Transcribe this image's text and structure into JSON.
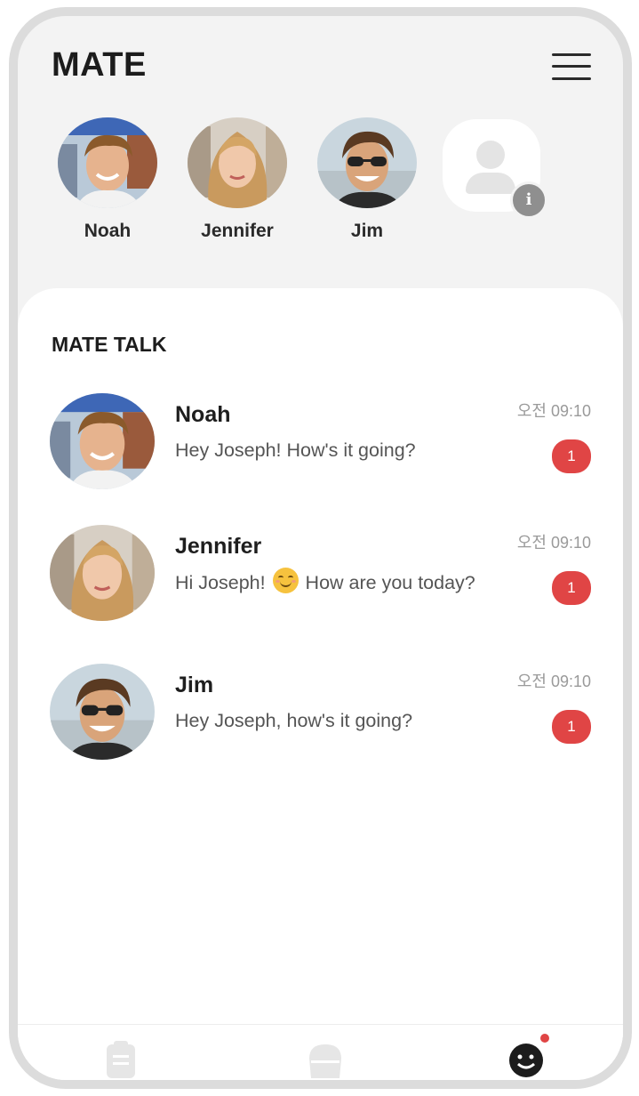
{
  "app": {
    "title": "MATE"
  },
  "mates": [
    {
      "name": "Noah"
    },
    {
      "name": "Jennifer"
    },
    {
      "name": "Jim"
    }
  ],
  "talk": {
    "section_title": "MATE TALK",
    "chats": [
      {
        "name": "Noah",
        "message": "Hey Joseph! How's it going?",
        "time": "오전 09:10",
        "unread": "1"
      },
      {
        "name": "Jennifer",
        "message_before_emoji": "Hi Joseph! ",
        "message_after_emoji": " How are you today?",
        "time": "오전 09:10",
        "unread": "1"
      },
      {
        "name": "Jim",
        "message": "Hey Joseph, how's it going?",
        "time": "오전 09:10",
        "unread": "1"
      }
    ]
  },
  "icons": {
    "menu": "hamburger-menu-icon",
    "info": "i",
    "tab_list": "clipboard-icon",
    "tab_home": "home-icon",
    "tab_mate": "smiley-face-icon"
  },
  "colors": {
    "accent_red": "#e04545",
    "background": "#f3f3f3",
    "panel": "#ffffff"
  }
}
